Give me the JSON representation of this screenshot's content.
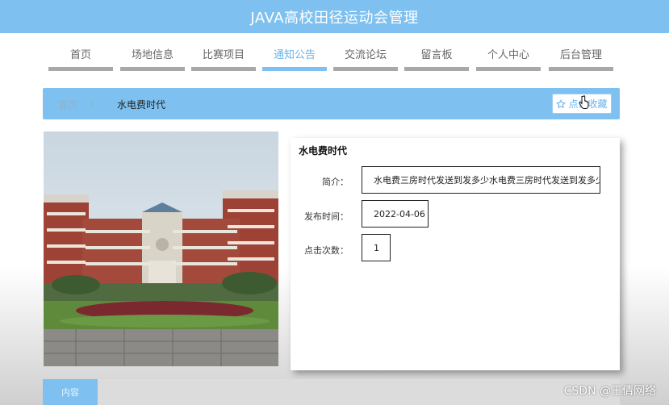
{
  "header": {
    "title": "JAVA高校田径运动会管理"
  },
  "nav": {
    "items": [
      {
        "label": "首页"
      },
      {
        "label": "场地信息"
      },
      {
        "label": "比赛项目"
      },
      {
        "label": "通知公告"
      },
      {
        "label": "交流论坛"
      },
      {
        "label": "留言板"
      },
      {
        "label": "个人中心"
      },
      {
        "label": "后台管理"
      }
    ],
    "active_index": 3
  },
  "breadcrumb": {
    "home": "首页",
    "separator": "/",
    "current": "水电费时代"
  },
  "favorite": {
    "label": "点击收藏",
    "icon": "star-outline-icon"
  },
  "detail": {
    "title": "水电费时代",
    "fields": [
      {
        "label": "简介：",
        "value": "水电费三房时代发送到发多少水电费三房时代发送到发多少"
      },
      {
        "label": "发布时间：",
        "value": "2022-04-06"
      },
      {
        "label": "点击次数：",
        "value": "1"
      }
    ]
  },
  "tabs": {
    "content": "内容"
  },
  "watermark": "CSDN @王倩网络",
  "colors": {
    "accent": "#7ec1f0",
    "accent_text": "#66b3ee",
    "nav_bar": "#a8a8a8"
  }
}
